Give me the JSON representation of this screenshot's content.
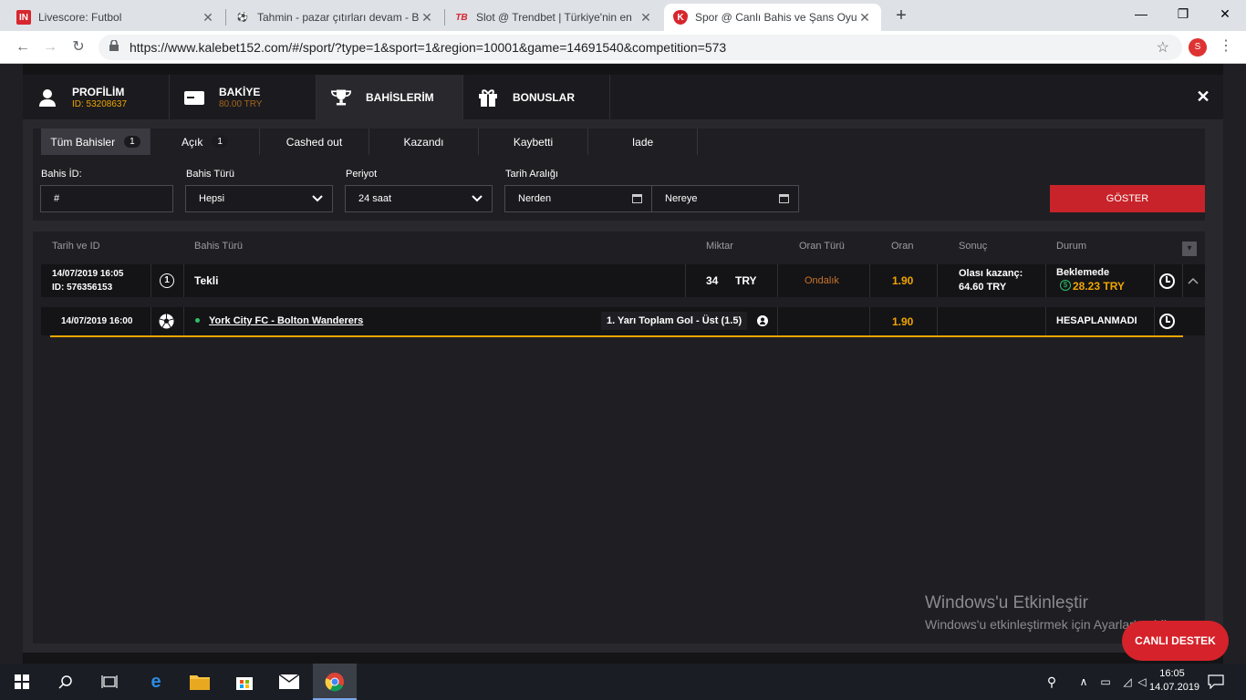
{
  "browser": {
    "tabs": [
      {
        "title": "Livescore: Futbol",
        "favicon": "IN"
      },
      {
        "title": "Tahmin - pazar çıtırları devam - B",
        "favicon": "⚽"
      },
      {
        "title": "Slot @ Trendbet | Türkiye'nin en",
        "favicon": "TB"
      },
      {
        "title": "Spor @ Canlı Bahis ve Şans Oyun",
        "favicon": "K"
      }
    ],
    "url": "https://www.kalebet152.com/#/sport/?type=1&sport=1&region=10001&game=14691540&competition=573",
    "profile_initial": "S"
  },
  "modal": {
    "tabs": {
      "profile": {
        "title": "PROFİLİM",
        "sub": "ID: 53208637"
      },
      "balance": {
        "title": "BAKİYE",
        "sub": "80.00 TRY"
      },
      "bets": {
        "title": "BAHİSLERİM"
      },
      "bonuses": {
        "title": "BONUSLAR"
      }
    },
    "close": "✕"
  },
  "filters": {
    "subtabs": [
      {
        "label": "Tüm Bahisler",
        "count": "1"
      },
      {
        "label": "Açık",
        "count": "1"
      },
      {
        "label": "Cashed out",
        "count": ""
      },
      {
        "label": "Kazandı",
        "count": ""
      },
      {
        "label": "Kaybetti",
        "count": ""
      },
      {
        "label": "Iade",
        "count": ""
      }
    ],
    "bet_id_label": "Bahis İD:",
    "bet_id_placeholder": "#",
    "bet_type_label": "Bahis Türü",
    "bet_type_value": "Hepsi",
    "period_label": "Periyot",
    "period_value": "24 saat",
    "date_range_label": "Tarih Aralığı",
    "from_value": "Nerden",
    "to_value": "Nereye",
    "show_button": "GÖSTER"
  },
  "table": {
    "headers": [
      "Tarih ve ID",
      "Bahis Türü",
      "Miktar",
      "Oran Türü",
      "Oran",
      "Sonuç",
      "Durum"
    ],
    "bet": {
      "datetime": "14/07/2019 16:05",
      "id": "ID: 576356153",
      "type_icon": "1",
      "type": "Tekli",
      "amount": "34",
      "currency": "TRY",
      "odds_type": "Ondalık",
      "odds": "1.90",
      "result_label": "Olası kazanç:",
      "result_value": "64.60 TRY",
      "status": "Beklemede",
      "cashout": "28.23 TRY"
    },
    "event": {
      "datetime": "14/07/2019 16:00",
      "match": "York City FC - Bolton Wanderers",
      "market": "1. Yarı Toplam Gol - Üst (1.5)",
      "odds": "1.90",
      "status": "HESAPLANMADI"
    }
  },
  "watermark": {
    "line1": "Windows'u Etkinleştir",
    "line2": "Windows'u etkinleştirmek için Ayarlar'a gidin."
  },
  "support_button": "CANLI DESTEK",
  "taskbar": {
    "time": "16:05",
    "date": "14.07.2019"
  }
}
